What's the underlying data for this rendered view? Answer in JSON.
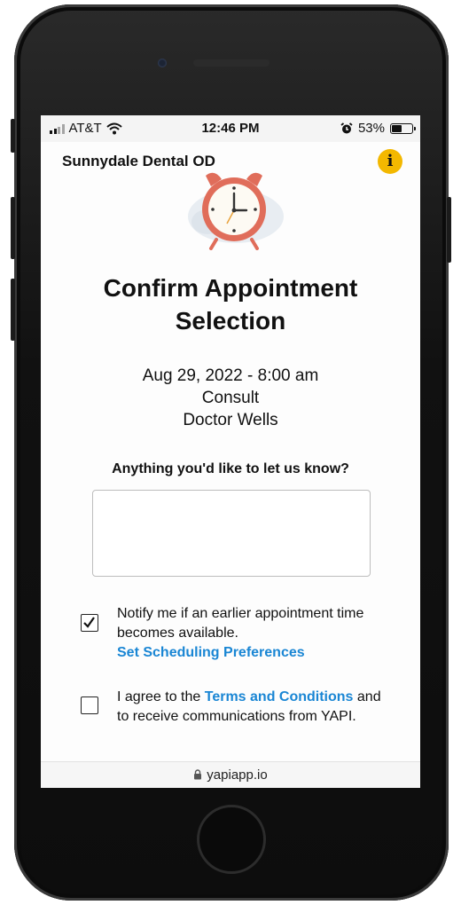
{
  "status_bar": {
    "carrier": "AT&T",
    "time": "12:46 PM",
    "battery_percent": "53%",
    "battery_level": 0.53
  },
  "header": {
    "clinic_name": "Sunnydale Dental OD",
    "info_label": "i",
    "accent_color": "#f3b800"
  },
  "main": {
    "title_line1": "Confirm Appointment",
    "title_line2": "Selection",
    "appointment": {
      "datetime": "Aug 29, 2022 - 8:00 am",
      "type": "Consult",
      "provider": "Doctor Wells"
    },
    "notes_label": "Anything you'd like to let us know?",
    "notes_value": "",
    "notify": {
      "checked": true,
      "text": "Notify me if an earlier appointment time becomes available.",
      "link": "Set Scheduling Preferences"
    },
    "terms": {
      "checked": false,
      "prefix": "I agree to the ",
      "link": "Terms and Conditions",
      "suffix": " and to receive communications from YAPI."
    },
    "link_color": "#1a86d4"
  },
  "browser": {
    "url": "yapiapp.io"
  },
  "icons": {
    "clock": "alarm-clock-icon",
    "check": "checkmark-icon",
    "lock": "lock-icon",
    "wifi": "wifi-icon",
    "alarm": "alarm-icon"
  }
}
